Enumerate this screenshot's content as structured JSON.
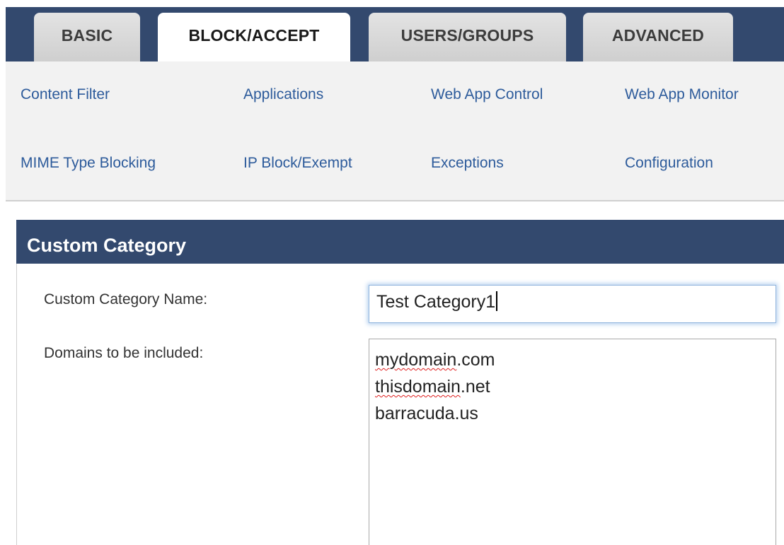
{
  "tabs": [
    {
      "label": "BASIC",
      "active": false
    },
    {
      "label": "BLOCK/ACCEPT",
      "active": true
    },
    {
      "label": "USERS/GROUPS",
      "active": false
    },
    {
      "label": "ADVANCED",
      "active": false
    }
  ],
  "subnav": {
    "items": [
      {
        "label": "Content Filter"
      },
      {
        "label": "Applications"
      },
      {
        "label": "Web App Control"
      },
      {
        "label": "Web App Monitor"
      },
      {
        "label": "MIME Type Blocking"
      },
      {
        "label": "IP Block/Exempt"
      },
      {
        "label": "Exceptions"
      },
      {
        "label": "Configuration"
      }
    ]
  },
  "panel": {
    "title": "Custom Category",
    "name_label": "Custom Category Name:",
    "name_value": "Test Category1",
    "domains_label": "Domains to be included:",
    "domains": [
      {
        "text": "mydomain",
        "suffix": ".com",
        "misspelled": true
      },
      {
        "text": "thisdomain",
        "suffix": ".net",
        "misspelled": true
      },
      {
        "text": "barracuda.us",
        "suffix": "",
        "misspelled": false
      }
    ]
  },
  "colors": {
    "header_bg": "#33496e",
    "link": "#2d5b9b",
    "subnav_bg": "#f2f2f2",
    "focus_glow": "#b9d3f0",
    "spellcheck": "#e02020"
  }
}
